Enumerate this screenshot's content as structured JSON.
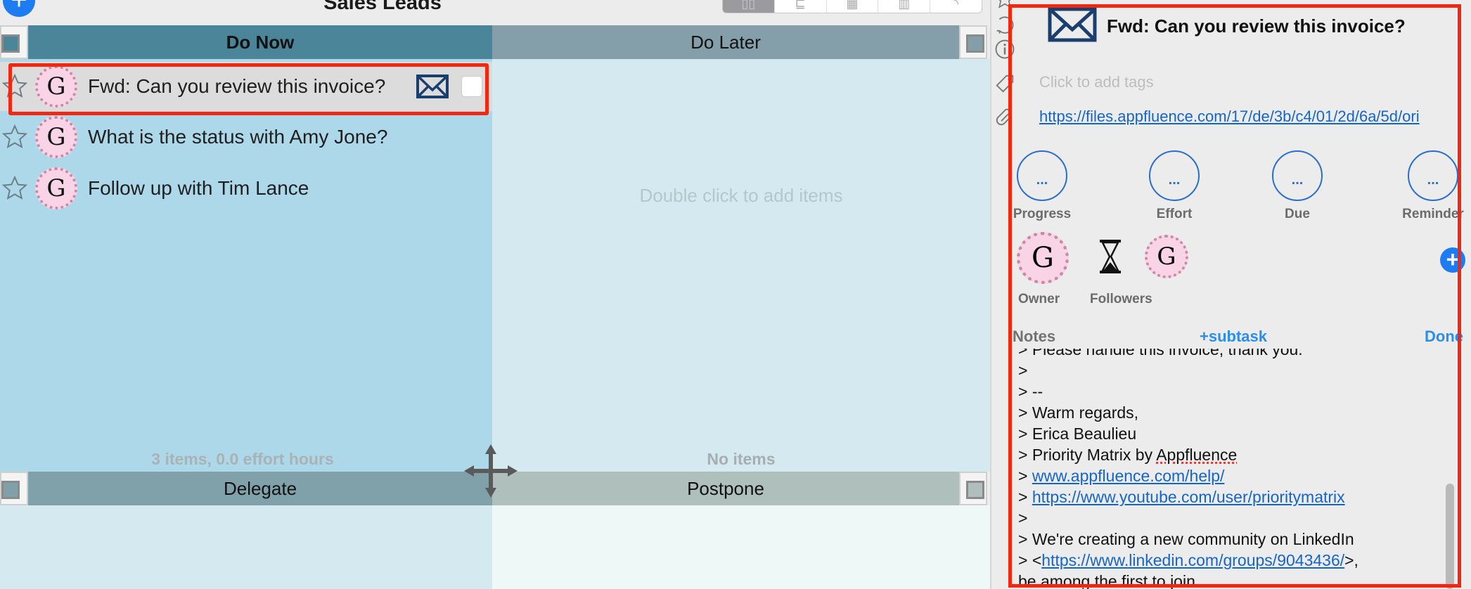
{
  "toolbar": {
    "add_label": "+",
    "board_title": "Sales Leads",
    "views": [
      {
        "name": "quadrants",
        "icon": "▯▯",
        "active": true
      },
      {
        "name": "gantt",
        "icon": "⊑",
        "active": false
      },
      {
        "name": "calendar",
        "icon": "▦",
        "active": false
      },
      {
        "name": "chart",
        "icon": "▥",
        "active": false
      },
      {
        "name": "feed",
        "icon": "◝",
        "active": false
      }
    ]
  },
  "quadrants": {
    "do_now": {
      "title": "Do Now",
      "summary": "3 items, 0.0 effort hours",
      "tasks": [
        {
          "title": "Fwd: Can you review this invoice?",
          "avatar": "G",
          "starred": false,
          "has_mail": true,
          "selected": true
        },
        {
          "title": "What is the status with Amy Jone?",
          "avatar": "G",
          "starred": false,
          "has_mail": false,
          "selected": false
        },
        {
          "title": "Follow up with Tim Lance",
          "avatar": "G",
          "starred": false,
          "has_mail": false,
          "selected": false
        }
      ]
    },
    "do_later": {
      "title": "Do Later",
      "hint": "Double click to add items",
      "summary": "No items"
    },
    "delegate": {
      "title": "Delegate"
    },
    "postpone": {
      "title": "Postpone"
    }
  },
  "detail": {
    "title": "Fwd: Can you review this invoice?",
    "tags_placeholder": "Click to add tags",
    "attachment_url": "https://files.appfluence.com/17/de/3b/c4/01/2d/6a/5d/ori",
    "properties": [
      {
        "label": "Progress",
        "value": "..."
      },
      {
        "label": "Effort",
        "value": "..."
      },
      {
        "label": "Due",
        "value": "..."
      },
      {
        "label": "Reminder",
        "value": "..."
      }
    ],
    "owner_label": "Owner",
    "owner_avatar": "G",
    "followers_label": "Followers",
    "follower_avatar": "G",
    "add_follower_label": "+",
    "notes_label": "Notes",
    "subtask_label": "+subtask",
    "done_label": "Done",
    "notes_lines": [
      "> Please handle this invoice, thank you.",
      ">",
      "> --",
      "> Warm regards,",
      "> Erica Beaulieu"
    ],
    "notes_priority_prefix": "> Priority Matrix by ",
    "notes_priority_word": "Appfluence",
    "notes_link_1": "www.appfluence.com/help/",
    "notes_link_2": "https://www.youtube.com/user/prioritymatrix",
    "notes_blank": ">",
    "notes_community": "> We're creating a new community on LinkedIn",
    "notes_link_3": "https://www.linkedin.com/groups/9043436/",
    "notes_last": "be among the first to join."
  },
  "colors": {
    "accent": "#1e7cf2",
    "selection_outline": "#f3260f",
    "do_now_header": "#4b8599",
    "do_later_header": "#849fa9",
    "delegate_header": "#80a0aa",
    "postpone_header": "#afbfbc",
    "link": "#1565c8"
  }
}
